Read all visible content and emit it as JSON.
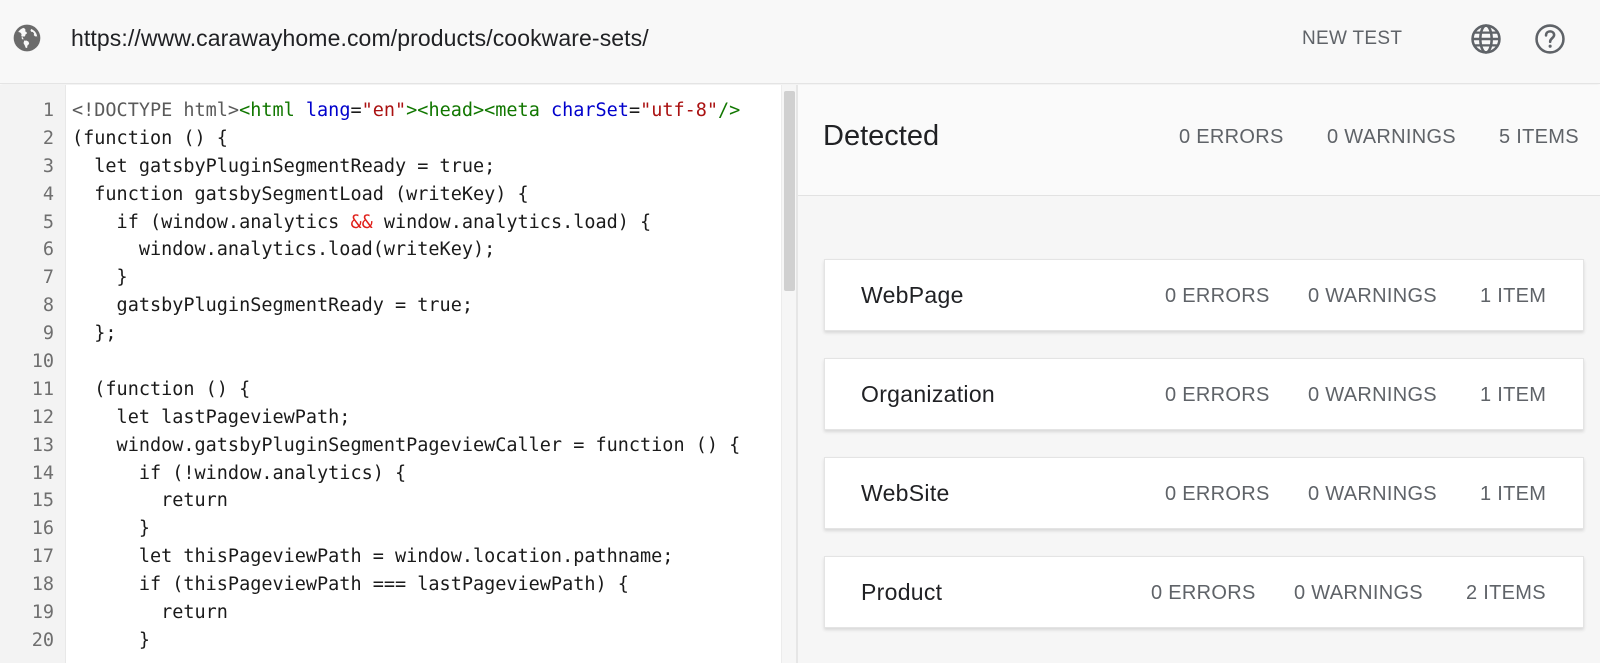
{
  "topbar": {
    "url": "https://www.carawayhome.com/products/cookware-sets/",
    "new_test_label": "NEW TEST",
    "icons": {
      "left": "globe-icon",
      "language": "language-icon",
      "help": "help-icon"
    }
  },
  "code": {
    "lines": [
      {
        "n": "1",
        "tokens": [
          {
            "t": "<!DOCTYPE html>",
            "c": "gray"
          },
          {
            "t": "<html ",
            "c": "tag"
          },
          {
            "t": "lang",
            "c": "attr"
          },
          {
            "t": "=",
            "c": "plain"
          },
          {
            "t": "\"en\"",
            "c": "str"
          },
          {
            "t": "><head><meta ",
            "c": "tag"
          },
          {
            "t": "charSet",
            "c": "attr"
          },
          {
            "t": "=",
            "c": "plain"
          },
          {
            "t": "\"utf-8\"",
            "c": "str"
          },
          {
            "t": "/>",
            "c": "tag"
          }
        ]
      },
      {
        "n": "2",
        "tokens": [
          {
            "t": "(function () {",
            "c": "plain"
          }
        ]
      },
      {
        "n": "3",
        "tokens": [
          {
            "t": "  let gatsbyPluginSegmentReady = true;",
            "c": "plain"
          }
        ]
      },
      {
        "n": "4",
        "tokens": [
          {
            "t": "  function gatsbySegmentLoad (writeKey) {",
            "c": "plain"
          }
        ]
      },
      {
        "n": "5",
        "tokens": [
          {
            "t": "    if (window.analytics ",
            "c": "plain"
          },
          {
            "t": "&&",
            "c": "op"
          },
          {
            "t": " window.analytics.load) {",
            "c": "plain"
          }
        ]
      },
      {
        "n": "6",
        "tokens": [
          {
            "t": "      window.analytics.load(writeKey);",
            "c": "plain"
          }
        ]
      },
      {
        "n": "7",
        "tokens": [
          {
            "t": "    }",
            "c": "plain"
          }
        ]
      },
      {
        "n": "8",
        "tokens": [
          {
            "t": "    gatsbyPluginSegmentReady = true;",
            "c": "plain"
          }
        ]
      },
      {
        "n": "9",
        "tokens": [
          {
            "t": "  };",
            "c": "plain"
          }
        ]
      },
      {
        "n": "10",
        "tokens": [
          {
            "t": "",
            "c": "plain"
          }
        ]
      },
      {
        "n": "11",
        "tokens": [
          {
            "t": "  (function () {",
            "c": "plain"
          }
        ]
      },
      {
        "n": "12",
        "tokens": [
          {
            "t": "    let lastPageviewPath;",
            "c": "plain"
          }
        ]
      },
      {
        "n": "13",
        "tokens": [
          {
            "t": "    window.gatsbyPluginSegmentPageviewCaller = function () {",
            "c": "plain"
          }
        ]
      },
      {
        "n": "14",
        "tokens": [
          {
            "t": "      if (!window.analytics) {",
            "c": "plain"
          }
        ]
      },
      {
        "n": "15",
        "tokens": [
          {
            "t": "        return",
            "c": "plain"
          }
        ]
      },
      {
        "n": "16",
        "tokens": [
          {
            "t": "      }",
            "c": "plain"
          }
        ]
      },
      {
        "n": "17",
        "tokens": [
          {
            "t": "      let thisPageviewPath = window.location.pathname;",
            "c": "plain"
          }
        ]
      },
      {
        "n": "18",
        "tokens": [
          {
            "t": "      if (thisPageviewPath === lastPageviewPath) {",
            "c": "plain"
          }
        ]
      },
      {
        "n": "19",
        "tokens": [
          {
            "t": "        return",
            "c": "plain"
          }
        ]
      },
      {
        "n": "20",
        "tokens": [
          {
            "t": "      }",
            "c": "plain"
          }
        ]
      }
    ]
  },
  "results": {
    "title": "Detected",
    "summary": {
      "errors": "0 ERRORS",
      "warnings": "0 WARNINGS",
      "items": "5 ITEMS"
    },
    "cards": [
      {
        "name": "WebPage",
        "errors": "0 ERRORS",
        "warnings": "0 WARNINGS",
        "items": "1 ITEM"
      },
      {
        "name": "Organization",
        "errors": "0 ERRORS",
        "warnings": "0 WARNINGS",
        "items": "1 ITEM"
      },
      {
        "name": "WebSite",
        "errors": "0 ERRORS",
        "warnings": "0 WARNINGS",
        "items": "1 ITEM"
      },
      {
        "name": "Product",
        "errors": "0 ERRORS",
        "warnings": "0 WARNINGS",
        "items": "2 ITEMS"
      }
    ]
  },
  "colors": {
    "code_tag": "#117700",
    "code_attr": "#0000cc",
    "code_string": "#aa1111",
    "code_operator": "#e0201a",
    "muted_text": "#5f6368"
  }
}
